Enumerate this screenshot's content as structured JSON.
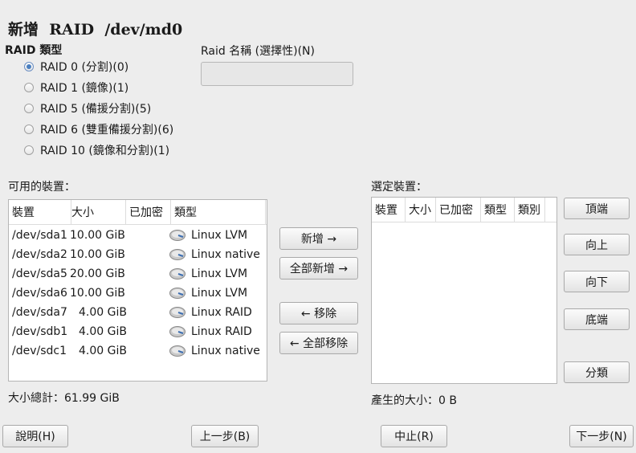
{
  "window": {
    "title": "新增  RAID  /dev/md0"
  },
  "raid_type": {
    "label": "RAID 類型",
    "options": [
      {
        "label": "RAID 0 (分割)(0)",
        "selected": true
      },
      {
        "label": "RAID 1 (鏡像)(1)",
        "selected": false
      },
      {
        "label": "RAID 5 (備援分割)(5)",
        "selected": false
      },
      {
        "label": "RAID 6 (雙重備援分割)(6)",
        "selected": false
      },
      {
        "label": "RAID 10 (鏡像和分割)(1)",
        "selected": false
      }
    ]
  },
  "raid_name": {
    "label": "Raid 名稱 (選擇性)(N)",
    "value": ""
  },
  "available": {
    "label": "可用的裝置：",
    "columns": [
      "裝置",
      "大小",
      "已加密",
      "類型"
    ],
    "rows": [
      {
        "device": "/dev/sda1",
        "size": "10.00 GiB",
        "encrypted": "",
        "type": "Linux LVM",
        "icon": "disk-icon"
      },
      {
        "device": "/dev/sda2",
        "size": "10.00 GiB",
        "encrypted": "",
        "type": "Linux native",
        "icon": "disk-icon"
      },
      {
        "device": "/dev/sda5",
        "size": "20.00 GiB",
        "encrypted": "",
        "type": "Linux LVM",
        "icon": "disk-icon"
      },
      {
        "device": "/dev/sda6",
        "size": "10.00 GiB",
        "encrypted": "",
        "type": "Linux LVM",
        "icon": "disk-icon"
      },
      {
        "device": "/dev/sda7",
        "size": "4.00 GiB",
        "encrypted": "",
        "type": "Linux RAID",
        "icon": "disk-icon"
      },
      {
        "device": "/dev/sdb1",
        "size": "4.00 GiB",
        "encrypted": "",
        "type": "Linux RAID",
        "icon": "disk-icon"
      },
      {
        "device": "/dev/sdc1",
        "size": "4.00 GiB",
        "encrypted": "",
        "type": "Linux native",
        "icon": "disk-icon"
      }
    ],
    "total": "大小總計：61.99 GiB"
  },
  "actions": {
    "add": "新增 →",
    "add_all": "全部新增 →",
    "remove": "← 移除",
    "remove_all": "← 全部移除"
  },
  "selected": {
    "label": "選定裝置：",
    "columns": [
      "裝置",
      "大小",
      "已加密",
      "類型",
      "類別"
    ],
    "rows": [],
    "result_size": "產生的大小：0 B"
  },
  "order_buttons": {
    "top": "頂端",
    "up": "向上",
    "down": "向下",
    "bottom": "底端",
    "classify": "分類"
  },
  "footer": {
    "help": "說明(H)",
    "back": "上一步(B)",
    "cancel": "中止(R)",
    "next": "下一步(N)"
  },
  "colors": {
    "background": "#ededed",
    "accent": "#4a7fc0",
    "list_bg": "#ffffff"
  }
}
